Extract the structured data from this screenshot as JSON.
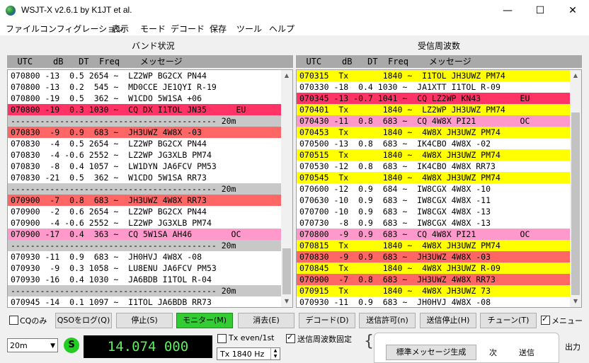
{
  "window": {
    "title": "WSJT-X   v2.6.1   by K1JT et al.",
    "minimize": "—",
    "maximize": "☐",
    "close": "✕"
  },
  "menu": [
    "ファイル",
    "コンフィグレーション",
    "表示",
    "モード",
    "デコード",
    "保存",
    "ツール",
    "ヘルプ"
  ],
  "left_panel": {
    "title": "バンド状況",
    "header": "  UTC    dB   DT  Freq    メッセージ"
  },
  "right_panel": {
    "title": "受信周波数",
    "header": "  UTC    dB   DT  Freq    メッセージ"
  },
  "colors": {
    "yellow": "#ffff00",
    "red": "#ff6666",
    "pink": "#ff99cc",
    "magenta": "#ff3366",
    "sep": "#c8c8c8",
    "white": "#ffffff"
  },
  "left_rows": [
    {
      "text": "070800 -13  0.5 2654 ~  LZ2WP BG2CX PN44",
      "bg": "white"
    },
    {
      "text": "070800 -13  0.2  545 ~  MD0CCE JE1QYI R-19",
      "bg": "white"
    },
    {
      "text": "070800 -19  0.5  362 ~  W1CDO 5W1SA +06",
      "bg": "white"
    },
    {
      "text": "070800 -19  0.3 1030 ~  CQ DX I1TOL JN35      EU",
      "bg": "magenta"
    },
    {
      "text": "------------------------------------------ 20m",
      "bg": "sep"
    },
    {
      "text": "070830  -9  0.9  683 ~  JH3UWZ 4W8X -03",
      "bg": "red"
    },
    {
      "text": "070830  -4  0.5 2654 ~  LZ2WP BG2CX PN44",
      "bg": "white"
    },
    {
      "text": "070830  -4 -0.6 2552 ~  LZ2WP JG3XLB PM74",
      "bg": "white"
    },
    {
      "text": "070830  -8  0.4 1057 ~  LW1DYN JA6FCV PM53",
      "bg": "white"
    },
    {
      "text": "070830 -21  0.5  362 ~  W1CDO 5W1SA RR73",
      "bg": "white"
    },
    {
      "text": "------------------------------------------ 20m",
      "bg": "sep"
    },
    {
      "text": "070900  -7  0.8  683 ~  JH3UWZ 4W8X RR73",
      "bg": "red"
    },
    {
      "text": "070900  -2  0.6 2654 ~  LZ2WP BG2CX PN44",
      "bg": "white"
    },
    {
      "text": "070900  -4 -0.6 2552 ~  LZ2WP JG3XLB PM74",
      "bg": "white"
    },
    {
      "text": "070900 -17  0.4  363 ~  CQ 5W1SA AH46        OC",
      "bg": "pink"
    },
    {
      "text": "------------------------------------------ 20m",
      "bg": "sep"
    },
    {
      "text": "070930 -11  0.9  683 ~  JH0HVJ 4W8X -08",
      "bg": "white"
    },
    {
      "text": "070930  -9  0.3 1058 ~  LU8ENU JA6FCV PM53",
      "bg": "white"
    },
    {
      "text": "070930 -16  0.4 1030 ~  JA6BDB I1TOL R-04",
      "bg": "white"
    },
    {
      "text": "------------------------------------------ 20m",
      "bg": "sep"
    },
    {
      "text": "070945 -14  0.1 1097 ~  I1TOL JA6BDB RR73",
      "bg": "white"
    }
  ],
  "right_rows": [
    {
      "text": "070315  Tx       1840 ~  I1TOL JH3UWZ PM74",
      "bg": "yellow"
    },
    {
      "text": "070330 -18  0.4 1030 ~  JA1XTT I1TOL R-09",
      "bg": "white"
    },
    {
      "text": "070345 -13 -0.7 1041 ~  CQ LZ2WP KN43        EU",
      "bg": "magenta"
    },
    {
      "text": "070401  Tx       1840 ~  LZ2WP JH3UWZ PM74",
      "bg": "yellow"
    },
    {
      "text": "070430 -11  0.8  683 ~  CQ 4W8X PI21         OC",
      "bg": "pink"
    },
    {
      "text": "070453  Tx       1840 ~  4W8X JH3UWZ PM74",
      "bg": "yellow"
    },
    {
      "text": "070500 -13  0.8  683 ~  IK4CBO 4W8X -02",
      "bg": "white"
    },
    {
      "text": "070515  Tx       1840 ~  4W8X JH3UWZ PM74",
      "bg": "yellow"
    },
    {
      "text": "070530 -12  0.8  683 ~  IK4CBO 4W8X RR73",
      "bg": "white"
    },
    {
      "text": "070545  Tx       1840 ~  4W8X JH3UWZ PM74",
      "bg": "yellow"
    },
    {
      "text": "070600 -12  0.9  684 ~  IW8CGX 4W8X -10",
      "bg": "white"
    },
    {
      "text": "070630 -10  0.9  683 ~  IW8CGX 4W8X -11",
      "bg": "white"
    },
    {
      "text": "070700 -10  0.9  683 ~  IW8CGX 4W8X -13",
      "bg": "white"
    },
    {
      "text": "070730  -8  0.9  683 ~  IW8CGX 4W8X -13",
      "bg": "white"
    },
    {
      "text": "070800  -9  0.9  683 ~  CQ 4W8X PI21         OC",
      "bg": "pink"
    },
    {
      "text": "070815  Tx       1840 ~  4W8X JH3UWZ PM74",
      "bg": "yellow"
    },
    {
      "text": "070830  -9  0.9  683 ~  JH3UWZ 4W8X -03",
      "bg": "red"
    },
    {
      "text": "070845  Tx       1840 ~  4W8X JH3UWZ R-09",
      "bg": "yellow"
    },
    {
      "text": "070900  -7  0.8  683 ~  JH3UWZ 4W8X RR73",
      "bg": "red"
    },
    {
      "text": "070915  Tx       1840 ~  4W8X JH3UWZ 73",
      "bg": "yellow"
    },
    {
      "text": "070930 -11  0.9  683 ~  JH0HVJ 4W8X -08",
      "bg": "white"
    }
  ],
  "controls": {
    "cq_only": "CQのみ",
    "log_qso": "QSOをログ(Q)",
    "stop": "停止(S)",
    "monitor": "モニター(M)",
    "erase": "消去(E)",
    "decode": "デコード(D)",
    "enable_tx": "送信許可(n)",
    "halt_tx": "送信停止(H)",
    "tune": "チューン(T)",
    "menus": "メニュー"
  },
  "bottom": {
    "band": "20m",
    "s_badge": "S",
    "frequency": "14.074 000",
    "tx_even": "Tx even/1st",
    "hold_tx_freq": "送信周波数固定",
    "tx_freq_spin": "Tx  1840  Hz",
    "gen_std_msgs": "標準メッセージ生成",
    "next": "次",
    "send": "送信",
    "output": "出力"
  }
}
